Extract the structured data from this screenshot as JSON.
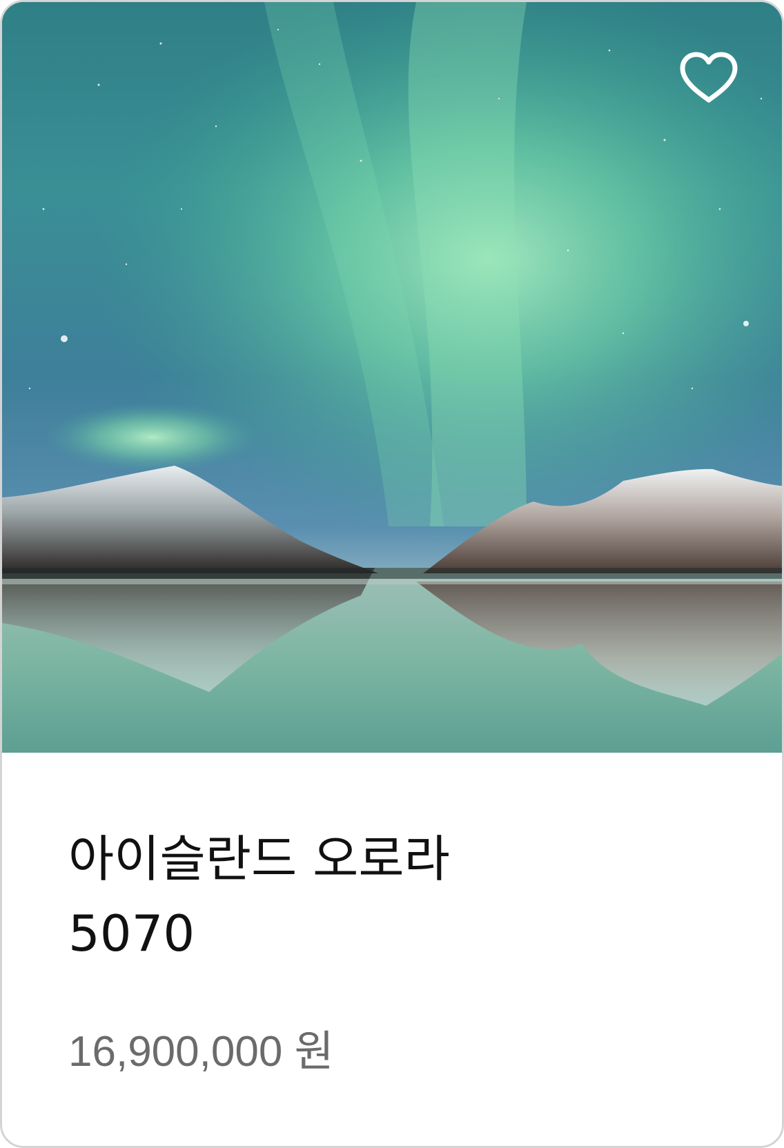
{
  "product": {
    "title_line1": "아이슬란드 오로라",
    "title_line2": "5070",
    "price": "16,900,000 원",
    "image": "northern-lights-over-snowy-mountains-and-lake",
    "favorite": false
  },
  "colors": {
    "card_border": "#d4d4d4",
    "title": "#111111",
    "price": "#6b6b6b",
    "heart": "#ffffff"
  },
  "icons": {
    "favorite": "heart-outline-icon"
  }
}
